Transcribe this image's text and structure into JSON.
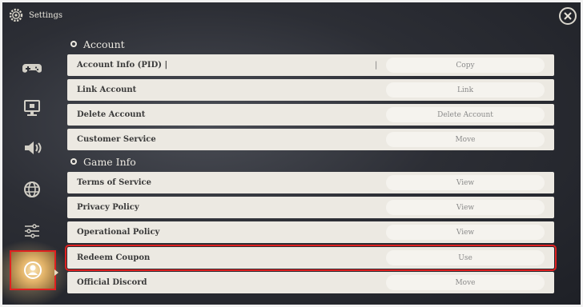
{
  "header": {
    "title": "Settings"
  },
  "sidebar": {
    "items": [
      {
        "name": "controller"
      },
      {
        "name": "display"
      },
      {
        "name": "audio"
      },
      {
        "name": "language"
      },
      {
        "name": "other-settings"
      },
      {
        "name": "account",
        "active": true
      }
    ]
  },
  "sections": [
    {
      "title": "Account",
      "rows": [
        {
          "label": "Account Info (PID) |",
          "cursor": "|",
          "action": "Copy"
        },
        {
          "label": "Link Account",
          "action": "Link"
        },
        {
          "label": "Delete Account",
          "action": "Delete Account"
        },
        {
          "label": "Customer Service",
          "action": "Move"
        }
      ]
    },
    {
      "title": "Game Info",
      "rows": [
        {
          "label": "Terms of Service",
          "action": "View"
        },
        {
          "label": "Privacy Policy",
          "action": "View"
        },
        {
          "label": "Operational Policy",
          "action": "View"
        },
        {
          "label": "Redeem Coupon",
          "action": "Use",
          "highlighted": true
        },
        {
          "label": "Official Discord",
          "action": "Move"
        }
      ]
    }
  ],
  "colors": {
    "highlight": "#e02020",
    "row_bg": "#ece9e2",
    "accent": "#e3b46a"
  }
}
